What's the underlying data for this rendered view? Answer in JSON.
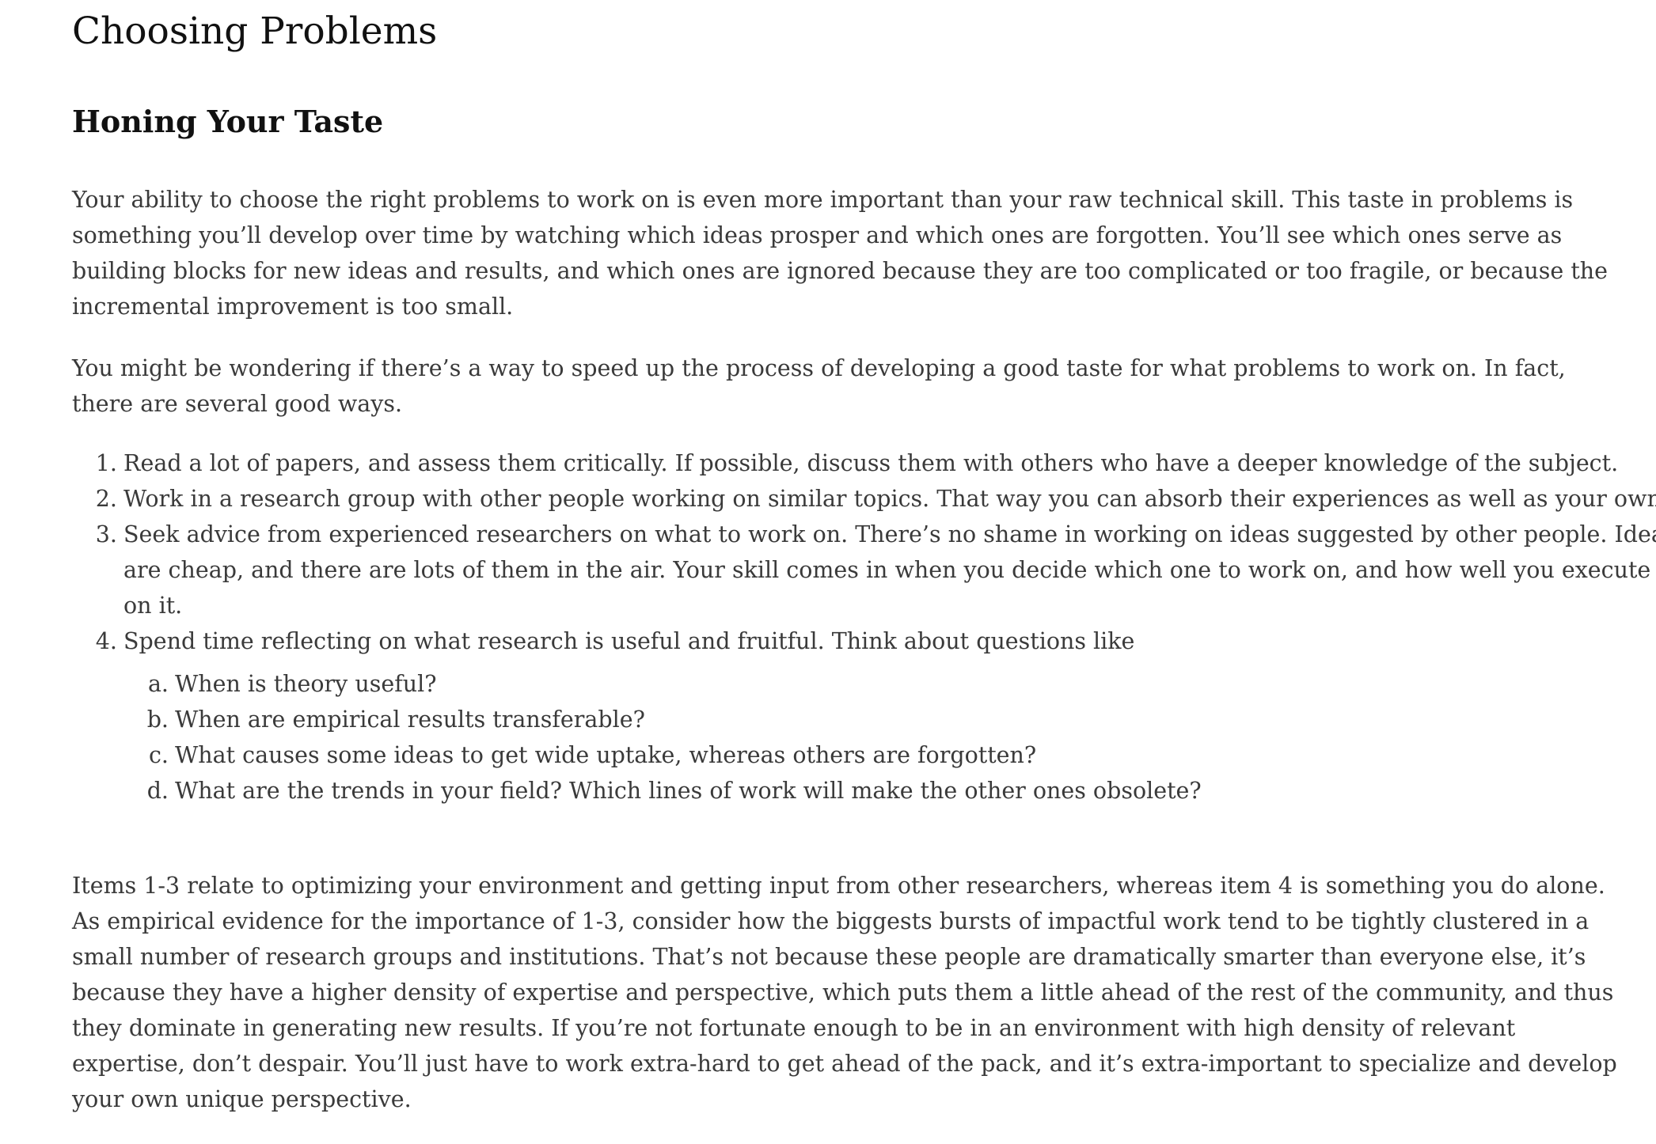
{
  "page": {
    "title": "Choosing Problems"
  },
  "section": {
    "title": "Honing Your Taste",
    "paragraphs": [
      "Your ability to choose the right problems to work on is even more important than your raw technical skill. This taste in problems is something you’ll develop over time by watching which ideas prosper and which ones are forgotten. You’ll see which ones serve as building blocks for new ideas and results, and which ones are ignored because they are too complicated or too fragile, or because the incremental improvement is too small.",
      "You might be wondering if there’s a way to speed up the process of developing a good taste for what problems to work on. In fact, there are several good ways.",
      "Items 1-3 relate to optimizing your environment and getting input from other researchers, whereas item 4 is something you do alone. As empirical evidence for the importance of 1-3, consider how the biggests bursts of impactful work tend to be tightly clustered in a small number of research groups and institutions. That’s not because these people are dramatically smarter than everyone else, it’s because they have a higher density of expertise and perspective, which puts them a little ahead of the rest of the community, and thus they dominate in generating new results. If you’re not fortunate enough to be in an environment with high density of relevant expertise, don’t despair. You’ll just have to work extra-hard to get ahead of the pack, and it’s extra-important to specialize and develop your own unique perspective."
    ],
    "list": [
      {
        "marker": "1.",
        "text": "Read a lot of papers, and assess them critically. If possible, discuss them with others who have a deeper knowledge of the subject."
      },
      {
        "marker": "2.",
        "text": "Work in a research group with other people working on similar topics. That way you can absorb their experiences as well as your own."
      },
      {
        "marker": "3.",
        "text": "Seek advice from experienced researchers on what to work on. There’s no shame in working on ideas suggested by other people. Ideas are cheap, and there are lots of them in the air. Your skill comes in when you decide which one to work on, and how well you execute on it."
      },
      {
        "marker": "4.",
        "text": "Spend time reflecting on what research is useful and fruitful. Think about questions like"
      }
    ],
    "sublist": [
      {
        "marker": "a.",
        "text": "When is theory useful?"
      },
      {
        "marker": "b.",
        "text": "When are empirical results transferable?"
      },
      {
        "marker": "c.",
        "text": "What causes some ideas to get wide uptake, whereas others are forgotten?"
      },
      {
        "marker": "d.",
        "text": "What are the trends in your field? Which lines of work will make the other ones obsolete?"
      }
    ]
  }
}
